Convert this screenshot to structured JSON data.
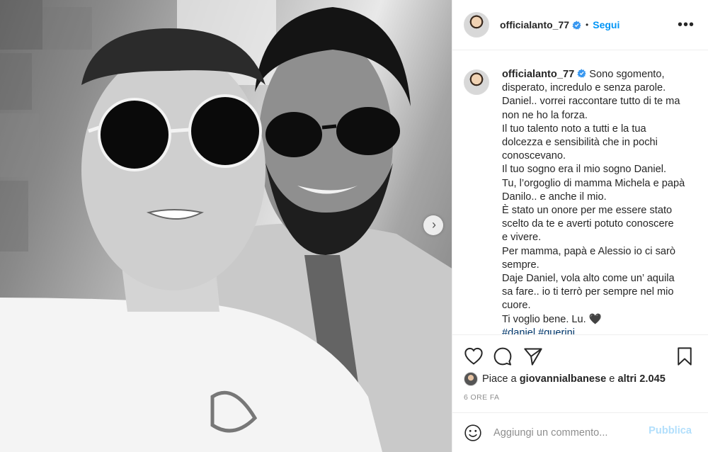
{
  "post": {
    "username": "officialanto_77",
    "verified_icon": "verified-badge-icon",
    "dot": "•",
    "follow_label": "Segui",
    "more_label": "•••",
    "accent_color": "#0095f6"
  },
  "caption": {
    "username": "officialanto_77",
    "first_line": "Sono sgomento,",
    "lines": [
      "disperato, incredulo e senza parole.",
      "Daniel.. vorrei raccontare tutto di te ma",
      "non ne ho la forza.",
      "Il tuo talento noto a tutti e la tua",
      "dolcezza e sensibilità che in pochi",
      "conoscevano.",
      "Il tuo sogno era il mio sogno Daniel.",
      "Tu, l’orgoglio di mamma Michela e papà",
      "Danilo.. e anche il mio.",
      "È stato un onore per me essere stato",
      "scelto da te e averti potuto conoscere",
      "e vivere.",
      "Per mamma, papà e Alessio io ci sarò",
      "sempre.",
      "Daje Daniel, vola alto come un’ aquila",
      "sa fare.. io ti terrò per sempre nel mio",
      "cuore.",
      "Ti voglio bene. Lu. 🖤"
    ],
    "hashtags": [
      "#daniel",
      "#guerini"
    ]
  },
  "actions": {
    "like_icon": "heart-icon",
    "comment_icon": "comment-bubble-icon",
    "share_icon": "paper-plane-icon",
    "save_icon": "bookmark-icon"
  },
  "likes": {
    "prefix": "Piace a",
    "liker": "giovannialbanese",
    "conjunction": "e",
    "others": "altri 2.045"
  },
  "timestamp": "6 ORE FA",
  "comment": {
    "placeholder": "Aggiungi un commento...",
    "post_label": "Pubblica",
    "emoji_icon": "emoji-smile-icon"
  },
  "carousel": {
    "next_label": "›"
  }
}
